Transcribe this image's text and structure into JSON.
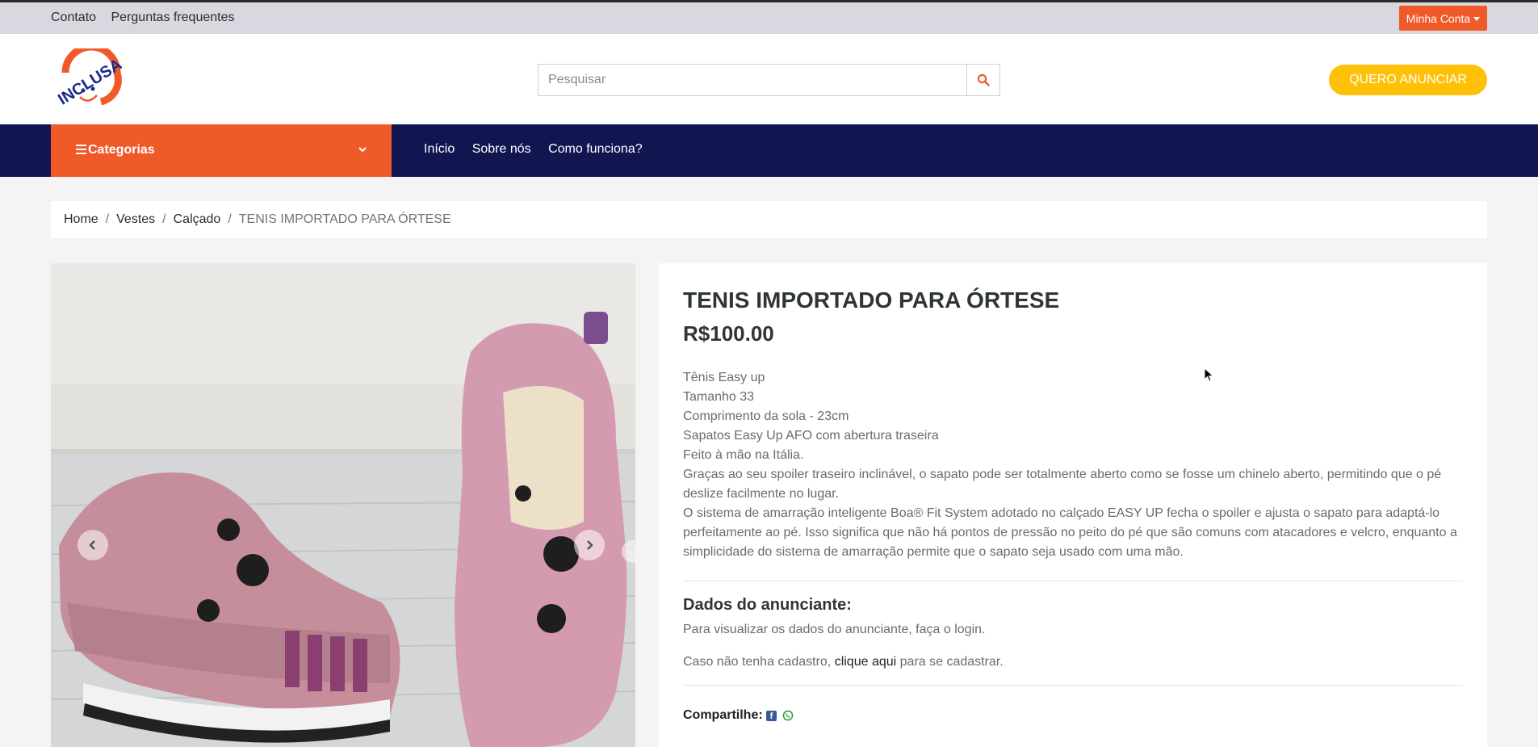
{
  "topbar": {
    "links": [
      "Contato",
      "Perguntas frequentes"
    ],
    "account_label": "Minha Conta"
  },
  "header": {
    "logo_text": "INCLUSA",
    "search_placeholder": "Pesquisar",
    "cta_label": "QUERO ANUNCIAR"
  },
  "nav": {
    "categories_label": "Categorias",
    "links": [
      "Início",
      "Sobre nós",
      "Como funciona?"
    ]
  },
  "breadcrumb": [
    "Home",
    "Vestes",
    "Calçado",
    "TENIS IMPORTADO PARA ÓRTESE"
  ],
  "product": {
    "title": "TENIS IMPORTADO PARA ÓRTESE",
    "price": "R$100.00",
    "description": [
      "Tênis Easy up",
      "Tamanho 33",
      "Comprimento da sola - 23cm",
      "Sapatos Easy Up AFO com abertura traseira",
      "Feito à mão na Itália.",
      "Graças ao seu spoiler traseiro inclinável, o sapato pode ser totalmente aberto como se fosse um chinelo aberto, permitindo que o pé deslize facilmente no lugar.",
      "O sistema de amarração inteligente Boa® Fit System adotado no calçado EASY UP fecha o spoiler e ajusta o sapato para adaptá-lo perfeitamente ao pé. Isso significa que não há pontos de pressão no peito do pé que são comuns com atacadores e velcro, enquanto a simplicidade do sistema de amarração permite que o sapato seja usado com uma mão."
    ]
  },
  "seller": {
    "heading": "Dados do anunciante:",
    "login_text": "Para visualizar os dados do anunciante, faça o login.",
    "register_prefix": "Caso não tenha cadastro,",
    "register_link": "clique aqui",
    "register_suffix": "para se cadastrar."
  },
  "share": {
    "label": "Compartilhe:",
    "icons": [
      "facebook-icon",
      "whatsapp-icon"
    ]
  },
  "colors": {
    "accent": "#f05a28",
    "navy": "#121650",
    "cta": "#ffc107"
  }
}
